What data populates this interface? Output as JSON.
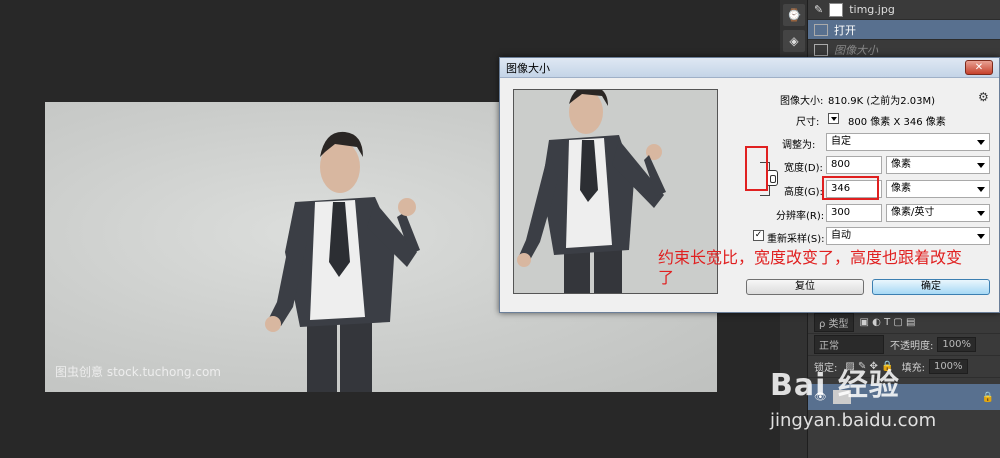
{
  "history": {
    "file_name": "timg.jpg",
    "items": [
      {
        "label": "打开",
        "active": true
      },
      {
        "label": "图像大小",
        "active": false
      }
    ]
  },
  "canvas": {
    "watermark": "图虫创意 stock.tuchong.com"
  },
  "dialog": {
    "title": "图像大小",
    "close_symbol": "✕",
    "image_size_label": "图像大小:",
    "image_size_value": "810.9K (之前为2.03M)",
    "dimensions_label": "尺寸:",
    "dimensions_value": "800 像素 X 346 像素",
    "fit_to_label": "调整为:",
    "fit_to_value": "自定",
    "width_label": "宽度(D):",
    "width_value": "800",
    "width_unit": "像素",
    "height_label": "高度(G):",
    "height_value": "346",
    "height_unit": "像素",
    "resolution_label": "分辨率(R):",
    "resolution_value": "300",
    "resolution_unit": "像素/英寸",
    "resample_label": "重新采样(S):",
    "resample_checked": true,
    "resample_value": "自动",
    "reset_button": "复位",
    "ok_button": "确定"
  },
  "annotation": {
    "line1": "约束长宽比，宽度改变了，高度也跟着改变",
    "line2": "了"
  },
  "layers": {
    "filter_kind": "ρ 类型",
    "blend_mode": "正常",
    "opacity_label": "不透明度:",
    "opacity_value": "100%",
    "lock_label": "锁定:",
    "fill_label": "填充:",
    "fill_value": "100%"
  },
  "branding": {
    "baidu_logo": "Bai 经验",
    "baidu_url": "jingyan.baidu.com"
  },
  "colors": {
    "accent_red": "#e02020",
    "selection_blue": "#58708f"
  }
}
